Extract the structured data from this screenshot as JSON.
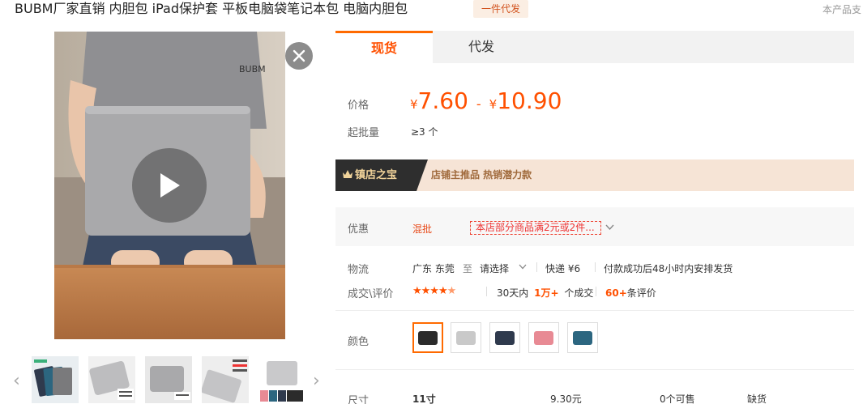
{
  "header": {
    "title": "BUBM厂家直销 内胆包 iPad保护套 平板电脑袋笔记本包 电脑内胆包",
    "badge": "一件代发",
    "support_text": "本产品支"
  },
  "tabs": [
    {
      "label": "现货",
      "active": true
    },
    {
      "label": "代发",
      "active": false
    }
  ],
  "price": {
    "label": "价格",
    "currency": "¥",
    "min": "7.60",
    "separator": "-",
    "max": "10.90"
  },
  "moq": {
    "label": "起批量",
    "value": "≥3 个"
  },
  "treasure": {
    "title": "镇店之宝",
    "text": "店铺主推品   热销潜力款"
  },
  "promo": {
    "label": "优惠",
    "type": "混批",
    "tag": "本店部分商品满2元或2件..."
  },
  "logistics": {
    "label": "物流",
    "origin": "广东 东莞",
    "to": "至",
    "destination": "请选择",
    "express": "快递 ¥6",
    "shipping": "付款成功后48小时内安排发货"
  },
  "reviews": {
    "label": "成交\\评价",
    "rating": 4.5,
    "period": "30天内",
    "count": "1万+",
    "count_suffix": "个成交",
    "review_count": "60+",
    "review_suffix": "条评价"
  },
  "color": {
    "label": "颜色",
    "options": [
      {
        "name": "black",
        "color": "#2b2b2b",
        "selected": true
      },
      {
        "name": "gray",
        "color": "#c9c9c9",
        "selected": false
      },
      {
        "name": "navy",
        "color": "#2f3a4d",
        "selected": false
      },
      {
        "name": "pink",
        "color": "#e88a94",
        "selected": false
      },
      {
        "name": "teal",
        "color": "#2c6680",
        "selected": false
      }
    ]
  },
  "size_row": {
    "label": "尺寸",
    "size": "11寸",
    "price": "9.30元",
    "stock": "0个可售",
    "status": "缺货"
  },
  "icons": {
    "close": "close-icon",
    "play": "play-icon",
    "prev": "chevron-left-icon",
    "next": "chevron-right-icon",
    "dropdown": "chevron-down-icon",
    "crown": "crown-icon"
  },
  "colors": {
    "accent": "#ff5000",
    "tab_border": "#ff6a00"
  }
}
